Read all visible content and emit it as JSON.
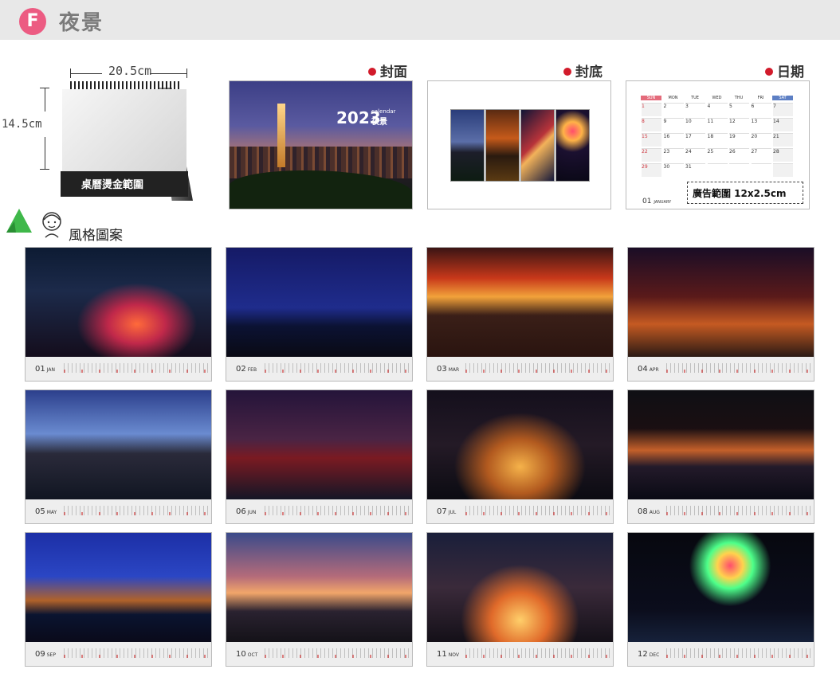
{
  "header": {
    "badge": "F",
    "title": "夜景"
  },
  "desk": {
    "width_label": "20.5cm",
    "height_label": "14.5cm",
    "band_text": "桌曆燙金範圍"
  },
  "sections": {
    "cover": "封面",
    "back": "封底",
    "date": "日期",
    "style": "風格圖案"
  },
  "cover": {
    "year": "2023",
    "sub_en": "calendar",
    "sub_zh": "夜景"
  },
  "date_page": {
    "weekdays": [
      "SUN",
      "MON",
      "TUE",
      "WED",
      "THU",
      "FRI",
      "SAT"
    ],
    "weeks": [
      [
        "1",
        "2",
        "3",
        "4",
        "5",
        "6",
        "7"
      ],
      [
        "8",
        "9",
        "10",
        "11",
        "12",
        "13",
        "14"
      ],
      [
        "15",
        "16",
        "17",
        "18",
        "19",
        "20",
        "21"
      ],
      [
        "22",
        "23",
        "24",
        "25",
        "26",
        "27",
        "28"
      ],
      [
        "29",
        "30",
        "31",
        "",
        "",
        "",
        ""
      ]
    ],
    "month_num": "01",
    "month_name": "JANUARY",
    "ad_label": "廣告範圍 12x2.5cm"
  },
  "months": [
    {
      "num": "01",
      "abbr": "JAN",
      "scene": "highway"
    },
    {
      "num": "02",
      "abbr": "FEB",
      "scene": "skyline"
    },
    {
      "num": "03",
      "abbr": "MAR",
      "scene": "bridge-sunset"
    },
    {
      "num": "04",
      "abbr": "APR",
      "scene": "cable-bridge"
    },
    {
      "num": "05",
      "abbr": "MAY",
      "scene": "coast-dusk"
    },
    {
      "num": "06",
      "abbr": "JUN",
      "scene": "river-bridge"
    },
    {
      "num": "07",
      "abbr": "JUL",
      "scene": "interchange"
    },
    {
      "num": "08",
      "abbr": "AUG",
      "scene": "temple"
    },
    {
      "num": "09",
      "abbr": "SEP",
      "scene": "harbor-city"
    },
    {
      "num": "10",
      "abbr": "OCT",
      "scene": "sunrise-valley"
    },
    {
      "num": "11",
      "abbr": "NOV",
      "scene": "city-street"
    },
    {
      "num": "12",
      "abbr": "DEC",
      "scene": "fireworks"
    }
  ],
  "colors": {
    "accent_pink": "#ec5b82",
    "dot_red": "#d21b2b",
    "header_bg": "#e8e8e8",
    "sun_header": "#e46b7b",
    "sat_header": "#5d7fc4"
  }
}
